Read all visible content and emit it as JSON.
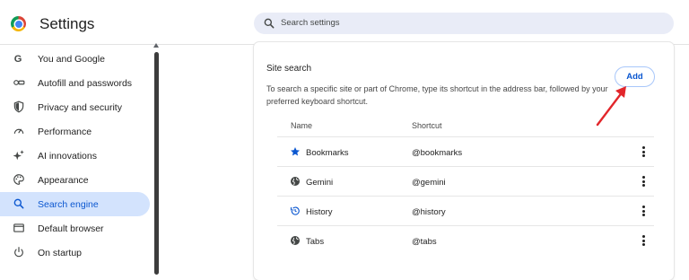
{
  "header": {
    "title": "Settings",
    "search_placeholder": "Search settings"
  },
  "sidebar": {
    "items": [
      {
        "label": "You and Google",
        "icon": "google-icon",
        "active": false
      },
      {
        "label": "Autofill and passwords",
        "icon": "key-icon",
        "active": false
      },
      {
        "label": "Privacy and security",
        "icon": "shield-icon",
        "active": false
      },
      {
        "label": "Performance",
        "icon": "speedometer-icon",
        "active": false
      },
      {
        "label": "AI innovations",
        "icon": "sparkle-icon",
        "active": false
      },
      {
        "label": "Appearance",
        "icon": "palette-icon",
        "active": false
      },
      {
        "label": "Search engine",
        "icon": "search-icon",
        "active": true
      },
      {
        "label": "Default browser",
        "icon": "browser-window-icon",
        "active": false
      },
      {
        "label": "On startup",
        "icon": "power-icon",
        "active": false
      }
    ]
  },
  "site_search": {
    "title": "Site search",
    "description": "To search a specific site or part of Chrome, type its shortcut in the address bar, followed by your preferred keyboard shortcut.",
    "add_label": "Add",
    "columns": {
      "name": "Name",
      "shortcut": "Shortcut"
    },
    "rows": [
      {
        "name": "Bookmarks",
        "shortcut": "@bookmarks",
        "icon": "star-icon"
      },
      {
        "name": "Gemini",
        "shortcut": "@gemini",
        "icon": "globe-icon"
      },
      {
        "name": "History",
        "shortcut": "@history",
        "icon": "history-icon"
      },
      {
        "name": "Tabs",
        "shortcut": "@tabs",
        "icon": "globe-icon"
      }
    ]
  },
  "colors": {
    "accent": "#0b57d0",
    "active_nav_bg": "#d3e3fd",
    "search_bg": "#e9ecf7",
    "annotation_arrow": "#e2262b"
  }
}
